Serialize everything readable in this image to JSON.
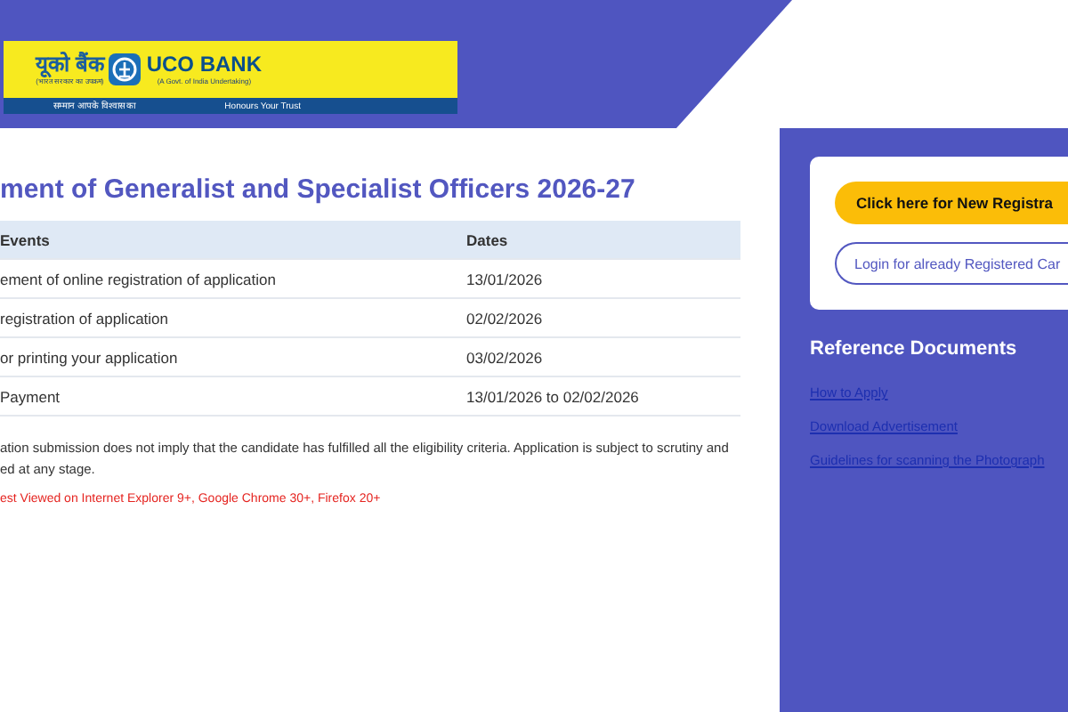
{
  "logo": {
    "hindi_name": "यूको बैंक",
    "hindi_subtitle": "(भारत सरकार का उपक्रम)",
    "name": "UCO BANK",
    "subtitle": "(A Govt. of India Undertaking)",
    "hindi_tagline": "सम्मान आपके विश्वास का",
    "tagline": "Honours Your Trust"
  },
  "title": "ment of Generalist and Specialist Officers 2026-27",
  "table": {
    "columns": [
      "Events",
      "Dates"
    ],
    "rows": [
      [
        "ement of online registration of application",
        "13/01/2026"
      ],
      [
        "registration of application",
        "02/02/2026"
      ],
      [
        "or printing your application",
        "03/02/2026"
      ],
      [
        "Payment",
        "13/01/2026 to 02/02/2026"
      ]
    ]
  },
  "note": "ation submission does not imply that the candidate has fulfilled all the eligibility criteria. Application is subject to scrutiny and ed at any stage.",
  "browser_note": "est Viewed on Internet Explorer 9+, Google Chrome 30+, Firefox 20+",
  "sidebar": {
    "primary_button": "Click here for New Registra",
    "secondary_button": "Login for already Registered Car",
    "heading": "Reference Documents",
    "links": [
      "How to Apply",
      "Download Advertisement",
      "Guidelines for scanning the Photograph"
    ]
  }
}
